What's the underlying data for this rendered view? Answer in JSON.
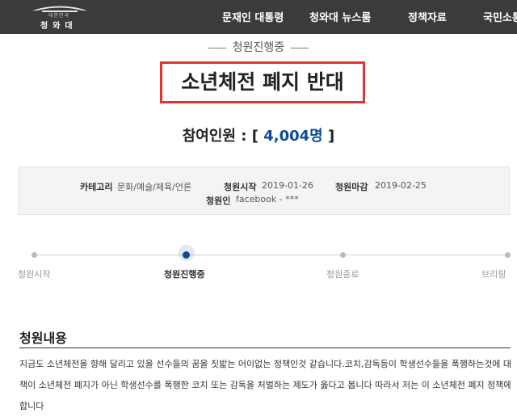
{
  "header": {
    "logo_small": "대한민국",
    "logo_name": "청와대",
    "nav": [
      "문재인 대통령",
      "청와대 뉴스룸",
      "정책자료",
      "국민소통"
    ]
  },
  "petition": {
    "status": "청원진행중",
    "title": "소년체전 폐지 반대",
    "count_label": "참여인원 :",
    "count_open": "[",
    "count_value": "4,004명",
    "count_close": "]"
  },
  "info": {
    "category_label": "카테고리",
    "category_value": "문화/예술/체육/언론",
    "start_label": "청원시작",
    "start_value": "2019-01-26",
    "end_label": "청원마감",
    "end_value": "2019-02-25",
    "author_label": "청원인",
    "author_value": "facebook - ***"
  },
  "progress": {
    "steps": [
      "청원시작",
      "청원진행중",
      "청원종료",
      "브리핑"
    ],
    "active_index": 1
  },
  "content": {
    "heading": "청원내용",
    "lines": [
      "지금도 소년체전을 향해 달리고 있을 선수들의 꿈을 짓밟는 어이없는 정책인것 같습니다.코치,감독등이 학생선수들을 폭행하는것에 대한 정",
      "책이 소년체전 폐지가 아닌 학생선수를 폭행한 코치 또는 감독을 처벌하는 제도가 옳다고 봅니다 따라서 저는 이 소년체전 폐지 정책에 반대",
      "합니다"
    ]
  },
  "colors": {
    "header_bg": "#3b3b3b",
    "accent": "#0b4b9e",
    "highlight": "#e03434"
  }
}
